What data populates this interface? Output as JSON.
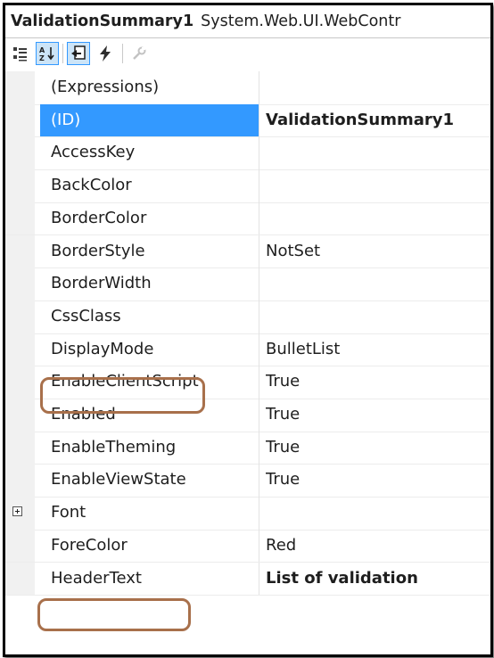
{
  "header": {
    "object_name": "ValidationSummary1",
    "object_type": "System.Web.UI.WebContr"
  },
  "toolbar": {
    "buttons": [
      {
        "icon": "categorized-icon",
        "active": false
      },
      {
        "icon": "alphabetical-icon",
        "active": true
      },
      {
        "icon": "properties-icon",
        "active": true
      },
      {
        "icon": "events-icon",
        "active": false
      },
      {
        "icon": "property-pages-icon",
        "active": false
      }
    ]
  },
  "properties": [
    {
      "name": "(Expressions)",
      "value": ""
    },
    {
      "name": "(ID)",
      "value": "ValidationSummary1",
      "bold": true,
      "selected": true
    },
    {
      "name": "AccessKey",
      "value": ""
    },
    {
      "name": "BackColor",
      "value": ""
    },
    {
      "name": "BorderColor",
      "value": ""
    },
    {
      "name": "BorderStyle",
      "value": "NotSet"
    },
    {
      "name": "BorderWidth",
      "value": ""
    },
    {
      "name": "CssClass",
      "value": ""
    },
    {
      "name": "DisplayMode",
      "value": "BulletList",
      "highlighted": true
    },
    {
      "name": "EnableClientScript",
      "value": "True"
    },
    {
      "name": "Enabled",
      "value": "True"
    },
    {
      "name": "EnableTheming",
      "value": "True"
    },
    {
      "name": "EnableViewState",
      "value": "True"
    },
    {
      "name": "Font",
      "value": "",
      "expandable": true
    },
    {
      "name": "ForeColor",
      "value": "Red"
    },
    {
      "name": "HeaderText",
      "value": "List of validation",
      "bold": true,
      "highlighted": true
    }
  ],
  "colors": {
    "selection": "#3399ff",
    "annotation": "#a8704b",
    "active_button_bg": "#cce4f7"
  }
}
